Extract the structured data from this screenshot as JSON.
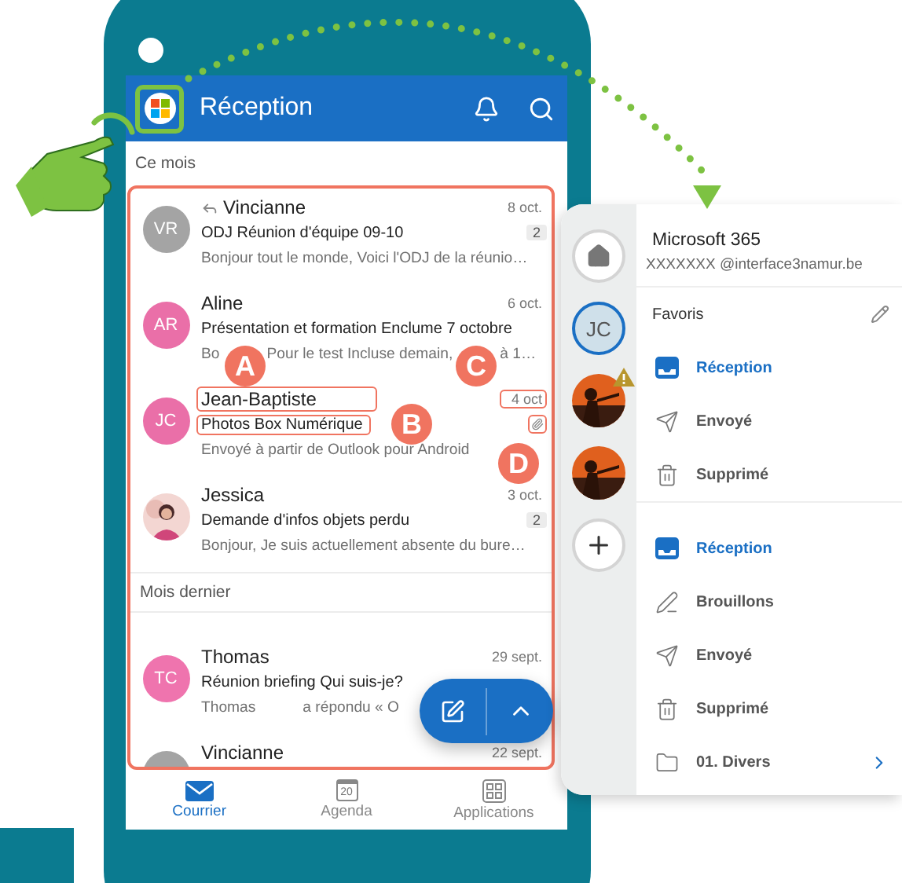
{
  "header": {
    "title": "Réception"
  },
  "mail_list": [
    {
      "kind": "section",
      "label": "Ce mois"
    },
    {
      "kind": "message",
      "avatar": {
        "kind": "initials",
        "initials": "VR",
        "color": "#a4a4a4"
      },
      "replied": true,
      "sender": "Vincianne",
      "date": "8 oct.",
      "subject": "ODJ Réunion d'équipe 09-10",
      "count": "2",
      "attachment": false,
      "preview": [
        "Bonjour tout le monde, Voici l'ODJ de la réunio…"
      ]
    },
    {
      "kind": "message",
      "avatar": {
        "kind": "initials",
        "initials": "AR",
        "color": "#ea6fa8"
      },
      "replied": false,
      "sender": "Aline",
      "date": "6 oct.",
      "subject": "Présentation et formation Enclume 7 octobre",
      "attachment": false,
      "preview": [
        "Bo",
        "Pour le test Incluse demain,",
        "à 1…"
      ]
    },
    {
      "kind": "message",
      "avatar": {
        "kind": "initials",
        "initials": "JC",
        "color": "#ea6fa8"
      },
      "replied": false,
      "sender": "Jean-Baptiste",
      "date": "4 oct",
      "subject": "Photos Box Numérique",
      "attachment": true,
      "preview": [
        "Envoyé à partir de Outlook pour Android"
      ],
      "callouts": [
        "A",
        "B",
        "C",
        "D"
      ]
    },
    {
      "kind": "message",
      "avatar": {
        "kind": "picture"
      },
      "replied": false,
      "sender": "Jessica",
      "date": "3 oct.",
      "subject": "Demande d'infos objets perdu",
      "count": "2",
      "attachment": false,
      "preview": [
        "Bonjour, Je suis actuellement absente du bure…"
      ]
    },
    {
      "kind": "section",
      "label": "Mois dernier"
    },
    {
      "kind": "message",
      "avatar": {
        "kind": "initials",
        "initials": "TC",
        "color": "#ef74ae"
      },
      "replied": false,
      "sender": "Thomas",
      "date": "29 sept.",
      "subject": "Réunion briefing Qui suis-je?",
      "attachment": false,
      "preview": [
        "Thomas",
        "a répondu « O"
      ]
    },
    {
      "kind": "message",
      "avatar": {
        "kind": "initials",
        "color": "#a4a4a4"
      },
      "replied": false,
      "sender": "Vincianne",
      "date": "22 sept."
    }
  ],
  "nav": [
    {
      "kind": "mail",
      "label": "Courrier",
      "selected": true
    },
    {
      "kind": "calendar",
      "label": "Agenda",
      "day": "20",
      "selected": false
    },
    {
      "kind": "apps",
      "label": "Applications",
      "selected": false
    }
  ],
  "panel": {
    "account": {
      "name": "Microsoft 365",
      "email": "XXXXXXX @interface3namur.be"
    },
    "accounts": [
      {
        "kind": "home",
        "selected": false
      },
      {
        "kind": "initials",
        "initials": "JC",
        "selected": true
      },
      {
        "kind": "picture",
        "warning": true,
        "selected": false
      },
      {
        "kind": "picture",
        "warning": false,
        "selected": false
      },
      {
        "kind": "add"
      }
    ],
    "favorites_label": "Favoris",
    "favorites": [
      {
        "kind": "inbox",
        "label": "Réception",
        "selected": true
      },
      {
        "kind": "sent",
        "label": "Envoyé",
        "selected": false
      },
      {
        "kind": "trash",
        "label": "Supprimé",
        "selected": false
      }
    ],
    "folders": [
      {
        "kind": "inbox",
        "label": "Réception",
        "selected": true
      },
      {
        "kind": "drafts",
        "label": "Brouillons",
        "selected": false
      },
      {
        "kind": "sent",
        "label": "Envoyé",
        "selected": false
      },
      {
        "kind": "trash",
        "label": "Supprimé",
        "selected": false
      },
      {
        "kind": "folder",
        "label": "01. Divers",
        "selected": false,
        "expandable": true
      }
    ]
  }
}
